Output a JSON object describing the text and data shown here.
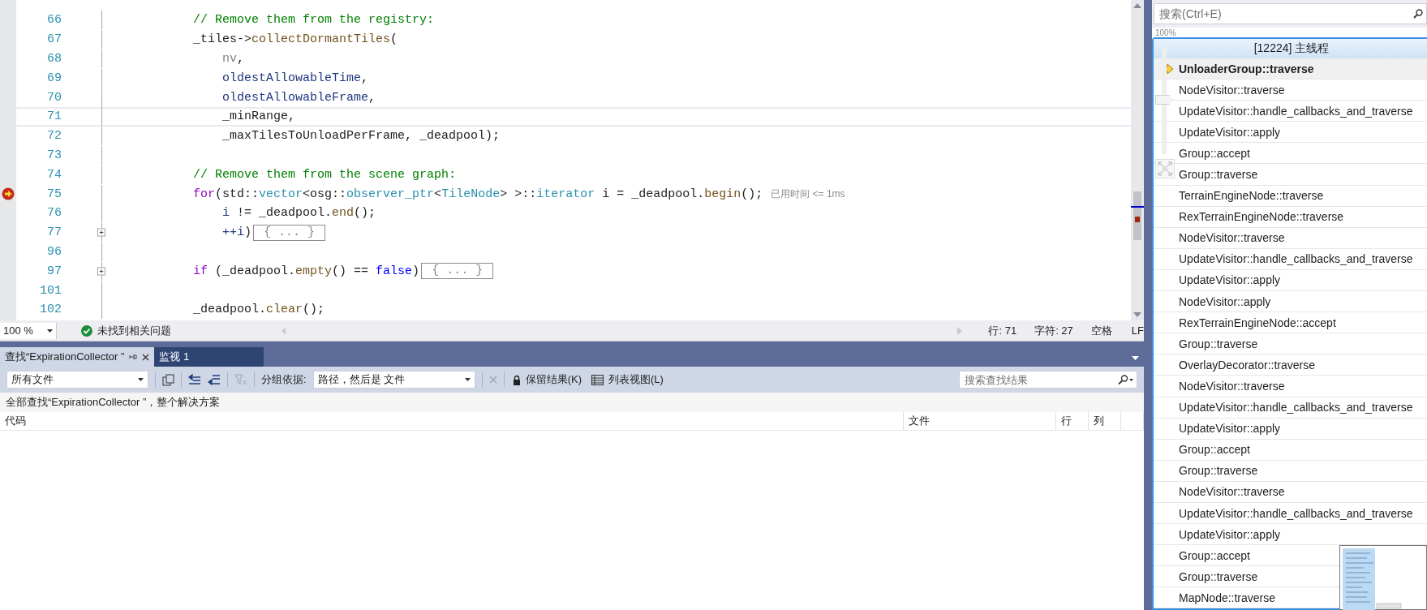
{
  "editor": {
    "lines": [
      {
        "number": "66",
        "tokens": [
          {
            "kind": "comment",
            "text": "            // Remove them from the registry:"
          }
        ],
        "current": false,
        "folded": false
      },
      {
        "number": "67",
        "tokens": [
          {
            "kind": "plain",
            "text": "            _tiles->"
          },
          {
            "kind": "method",
            "text": "collectDormantTiles"
          },
          {
            "kind": "plain",
            "text": "("
          }
        ],
        "current": false,
        "folded": false
      },
      {
        "number": "68",
        "tokens": [
          {
            "kind": "param",
            "text": "                nv"
          },
          {
            "kind": "plain",
            "text": ","
          }
        ],
        "current": false,
        "folded": false
      },
      {
        "number": "69",
        "tokens": [
          {
            "kind": "member",
            "text": "                oldestAllowableTime"
          },
          {
            "kind": "plain",
            "text": ","
          }
        ],
        "current": false,
        "folded": false
      },
      {
        "number": "70",
        "tokens": [
          {
            "kind": "member",
            "text": "                oldestAllowableFrame"
          },
          {
            "kind": "plain",
            "text": ","
          }
        ],
        "current": false,
        "folded": false
      },
      {
        "number": "71",
        "tokens": [
          {
            "kind": "plain",
            "text": "                _minRange,"
          }
        ],
        "current": true,
        "folded": false
      },
      {
        "number": "72",
        "tokens": [
          {
            "kind": "plain",
            "text": "                _maxTilesToUnloadPerFrame, _deadpool);"
          }
        ],
        "current": false,
        "folded": false
      },
      {
        "number": "73",
        "current": false,
        "folded": false
      },
      {
        "number": "74",
        "tokens": [
          {
            "kind": "comment",
            "text": "            // Remove them from the scene graph:"
          }
        ],
        "current": false,
        "folded": false
      },
      {
        "number": "75",
        "tokens": [
          {
            "kind": "keyword",
            "text": "            for"
          },
          {
            "kind": "plain",
            "text": "(std::"
          },
          {
            "kind": "type",
            "text": "vector"
          },
          {
            "kind": "plain",
            "text": "<osg::"
          },
          {
            "kind": "type",
            "text": "observer_ptr"
          },
          {
            "kind": "plain",
            "text": "<"
          },
          {
            "kind": "type",
            "text": "TileNode"
          },
          {
            "kind": "plain",
            "text": "> >::"
          },
          {
            "kind": "type",
            "text": "iterator"
          },
          {
            "kind": "plain",
            "text": " i = _deadpool."
          },
          {
            "kind": "method",
            "text": "begin"
          },
          {
            "kind": "plain",
            "text": "();"
          }
        ],
        "current": false,
        "folded": false,
        "next_statement": true,
        "hint": "已用时间 <= 1ms"
      },
      {
        "number": "76",
        "tokens": [
          {
            "kind": "local",
            "text": "                i"
          },
          {
            "kind": "plain",
            "text": " != _deadpool."
          },
          {
            "kind": "method",
            "text": "end"
          },
          {
            "kind": "plain",
            "text": "();"
          }
        ],
        "current": false,
        "folded": false
      },
      {
        "number": "77",
        "tokens": [
          {
            "kind": "local",
            "text": "                ++i"
          },
          {
            "kind": "plain",
            "text": ")"
          }
        ],
        "current": false,
        "folded": true,
        "collapsed_text": "{ ... }"
      },
      {
        "number": "96",
        "current": false,
        "folded": false
      },
      {
        "number": "97",
        "tokens": [
          {
            "kind": "keyword",
            "text": "            if"
          },
          {
            "kind": "plain",
            "text": " (_deadpool."
          },
          {
            "kind": "method",
            "text": "empty"
          },
          {
            "kind": "plain",
            "text": "() == "
          },
          {
            "kind": "literal",
            "text": "false"
          },
          {
            "kind": "plain",
            "text": ")"
          }
        ],
        "current": false,
        "folded": true,
        "collapsed_text": "{ ... }"
      },
      {
        "number": "101",
        "current": false,
        "folded": false
      },
      {
        "number": "102",
        "tokens": [
          {
            "kind": "plain",
            "text": "            _deadpool."
          },
          {
            "kind": "method",
            "text": "clear"
          },
          {
            "kind": "plain",
            "text": "();"
          }
        ],
        "current": false,
        "folded": false
      }
    ],
    "zoom": "100 %",
    "issues": "未找到相关问题",
    "line": "行: 71",
    "char": "字符: 27",
    "spacing": "空格",
    "eol": "LF"
  },
  "find_panel": {
    "tabs": [
      {
        "label": "查找“ExpirationCollector ”",
        "selected": true
      },
      {
        "label": "监视 1",
        "selected": false
      }
    ],
    "scope": "所有文件",
    "group_by_label": "分组依据:",
    "group_by": "路径，然后是 文件",
    "keep_results": "保留结果(K)",
    "list_view": "列表视图(L)",
    "search": {
      "placeholder": "搜索查找结果"
    },
    "summary": "全部查找“ExpirationCollector ”，整个解决方案",
    "columns": [
      "代码",
      "文件",
      "行",
      "列"
    ]
  },
  "parallel_stacks": {
    "search": {
      "placeholder": "搜索(Ctrl+E)"
    },
    "zoom_label": "100%",
    "zoom": {
      "level": 0.5
    },
    "thread": "[12224] 主线程",
    "frames": [
      {
        "name": "UnloaderGroup::traverse",
        "current": true
      },
      {
        "name": "NodeVisitor::traverse",
        "current": false
      },
      {
        "name": "UpdateVisitor::handle_callbacks_and_traverse",
        "current": false
      },
      {
        "name": "UpdateVisitor::apply",
        "current": false
      },
      {
        "name": "Group::accept",
        "current": false
      },
      {
        "name": "Group::traverse",
        "current": false
      },
      {
        "name": "TerrainEngineNode::traverse",
        "current": false
      },
      {
        "name": "RexTerrainEngineNode::traverse",
        "current": false
      },
      {
        "name": "NodeVisitor::traverse",
        "current": false
      },
      {
        "name": "UpdateVisitor::handle_callbacks_and_traverse",
        "current": false
      },
      {
        "name": "UpdateVisitor::apply",
        "current": false
      },
      {
        "name": "NodeVisitor::apply",
        "current": false
      },
      {
        "name": "RexTerrainEngineNode::accept",
        "current": false
      },
      {
        "name": "Group::traverse",
        "current": false
      },
      {
        "name": "OverlayDecorator::traverse",
        "current": false
      },
      {
        "name": "NodeVisitor::traverse",
        "current": false
      },
      {
        "name": "UpdateVisitor::handle_callbacks_and_traverse",
        "current": false
      },
      {
        "name": "UpdateVisitor::apply",
        "current": false
      },
      {
        "name": "Group::accept",
        "current": false
      },
      {
        "name": "Group::traverse",
        "current": false
      },
      {
        "name": "NodeVisitor::traverse",
        "current": false
      },
      {
        "name": "UpdateVisitor::handle_callbacks_and_traverse",
        "current": false
      },
      {
        "name": "UpdateVisitor::apply",
        "current": false
      },
      {
        "name": "Group::accept",
        "current": false
      },
      {
        "name": "Group::traverse",
        "current": false
      },
      {
        "name": "MapNode::traverse",
        "current": false
      }
    ]
  }
}
